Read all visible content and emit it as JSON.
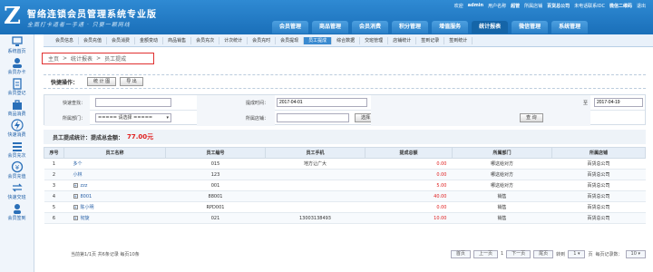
{
  "app": {
    "logo_letter": "Z",
    "title": "智络连锁会员管理系统专业版",
    "slogan": "全面打卡道者一手通 · 只要一颗网线"
  },
  "userbar": {
    "welcome": "欢迎",
    "user": "admin",
    "user_name_label": "用户名称",
    "user_name": "超管",
    "store_label": "所属店铺",
    "store": "百货总公司",
    "right_text": "未电话联系IDC",
    "wechat": "微信二维码",
    "exit": "退出"
  },
  "nav": [
    {
      "label": "会员管理"
    },
    {
      "label": "商品管理"
    },
    {
      "label": "会员消费"
    },
    {
      "label": "积分管理"
    },
    {
      "label": "增值服务"
    },
    {
      "label": "统计报表"
    },
    {
      "label": "微信管理"
    },
    {
      "label": "系统管理"
    }
  ],
  "subnav": [
    {
      "label": "会员信息"
    },
    {
      "label": "会员充值"
    },
    {
      "label": "会员消费"
    },
    {
      "label": "金额变动"
    },
    {
      "label": "商品销售"
    },
    {
      "label": "会员充次"
    },
    {
      "label": "计次统计"
    },
    {
      "label": "会员充时"
    },
    {
      "label": "会员提现"
    },
    {
      "label": "员工提成"
    },
    {
      "label": "综合数据"
    },
    {
      "label": "交班管理"
    },
    {
      "label": "店铺统计"
    },
    {
      "label": "签到记录"
    },
    {
      "label": "签到统计"
    }
  ],
  "sidebar": [
    {
      "label": "系统首页"
    },
    {
      "label": "会员办卡"
    },
    {
      "label": "会员登记"
    },
    {
      "label": "商品消费"
    },
    {
      "label": "快速消费"
    },
    {
      "label": "会员充次"
    },
    {
      "label": "会员充值"
    },
    {
      "label": "快速交班"
    },
    {
      "label": "会员签到"
    }
  ],
  "breadcrumb": {
    "home": "主页",
    "sep": ">",
    "level2": "统计报表",
    "level3": "员工提成"
  },
  "quick": {
    "label": "快捷操作：",
    "btn1": "统 计 图",
    "btn2": "导  出"
  },
  "filters": {
    "search_label": "快速查找：",
    "search_value": "",
    "time_label": "提成时间：",
    "time_from": "2017-04-01",
    "to_label": "至",
    "time_to": "2017-04-19",
    "dept_label": "所属部门：",
    "dept_value": "===== 请选择 =====",
    "store_label": "所属店铺：",
    "store_value": "",
    "select_btn": "选择",
    "query_btn": "查  询"
  },
  "summary": {
    "label": "员工提成统计：提成总金额：",
    "amount": "77.00元"
  },
  "table": {
    "headers": [
      "序号",
      "员工名称",
      "员工编号",
      "员工手机",
      "提成总额",
      "所属部门",
      "所属店铺"
    ],
    "rows": [
      {
        "no": "1",
        "name": "多个",
        "code": "015",
        "phone": "地方让广大",
        "amount": "0.00",
        "dept": "哪这给对方",
        "store": "百货总公司"
      },
      {
        "no": "2",
        "name": "小林",
        "code": "123",
        "phone": "",
        "amount": "0.00",
        "dept": "哪这给对方",
        "store": "百货总公司"
      },
      {
        "no": "3",
        "name": "zzz",
        "code": "001",
        "phone": "",
        "amount": "5.00",
        "dept": "哪这给对方",
        "store": "百货总公司"
      },
      {
        "no": "4",
        "name": "8001",
        "code": "88001",
        "phone": "",
        "amount": "40.00",
        "dept": "销售",
        "store": "百货总公司"
      },
      {
        "no": "5",
        "name": "陈小明",
        "code": "RPD001",
        "phone": "",
        "amount": "0.00",
        "dept": "销售",
        "store": "百货总公司"
      },
      {
        "no": "6",
        "name": "彻旋",
        "code": "021",
        "phone": "13003138493",
        "amount": "10.00",
        "dept": "销售",
        "store": "百货总公司"
      }
    ]
  },
  "pager": {
    "info": "当前第1/1页 共6条记录 每页10条",
    "first": "首页",
    "prev": "上一页",
    "page": "1",
    "next": "下一页",
    "last": "尾页",
    "goto_label": "转到",
    "goto_value": "1",
    "page_unit": "页",
    "per_page_label": "每页记录数：",
    "per_page": "10"
  }
}
